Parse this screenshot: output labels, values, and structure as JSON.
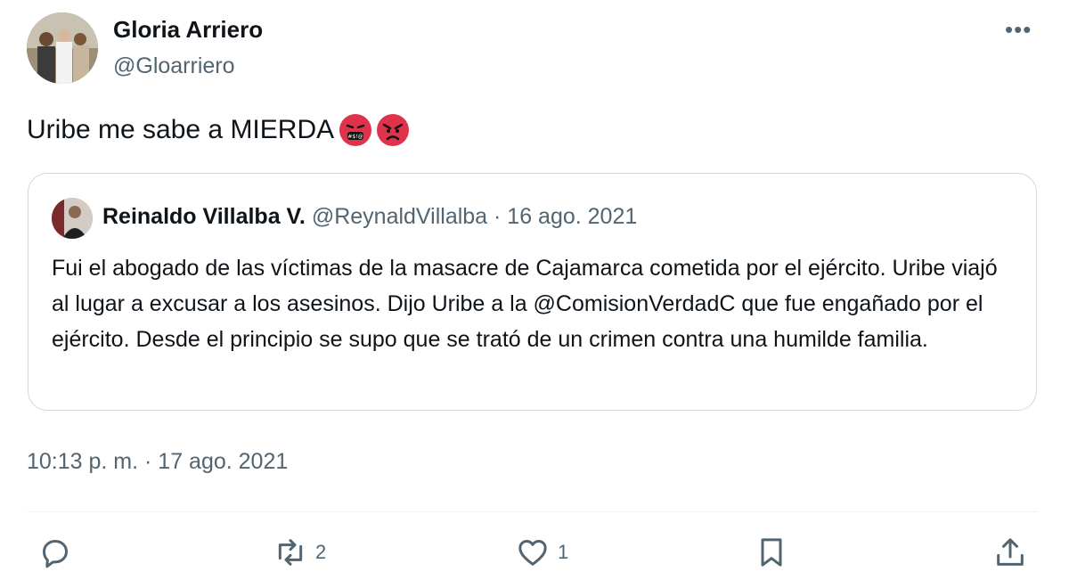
{
  "tweet": {
    "author_name": "Gloria Arriero",
    "author_handle": "@Gloarriero",
    "more_label": "•••",
    "text": "Uribe me sabe a MIERDA",
    "emojis": [
      "face-with-symbols-on-mouth",
      "angry-face"
    ],
    "timestamp": "10:13 p. m. · 17 ago. 2021"
  },
  "quoted": {
    "author_name": "Reinaldo Villalba V.",
    "meta": "@ReynaldVillalba · 16 ago. 2021",
    "text": "Fui el abogado de las víctimas de la masacre de Cajamarca cometida por el ejército. Uribe viajó al lugar a excusar a los asesinos.  Dijo Uribe a la @ComisionVerdadC que fue engañado por el ejército. Desde el principio se supo que se trató de un crimen contra una humilde familia."
  },
  "actions": {
    "reply": {
      "icon": "reply-icon",
      "count": ""
    },
    "retweet": {
      "icon": "retweet-icon",
      "count": "2"
    },
    "like": {
      "icon": "heart-icon",
      "count": "1"
    },
    "bookmark": {
      "icon": "bookmark-icon",
      "count": ""
    },
    "share": {
      "icon": "share-icon",
      "count": ""
    }
  },
  "colors": {
    "text": "#0f1419",
    "secondary": "#536471",
    "border": "#cfd9de",
    "emoji_red": "#e0324b"
  }
}
